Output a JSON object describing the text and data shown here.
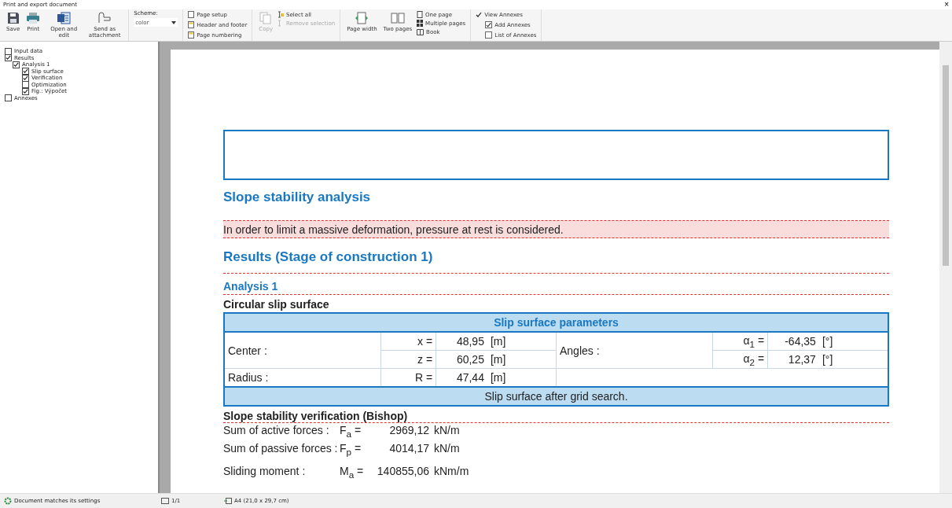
{
  "window": {
    "title": "Print and export document",
    "close": "×"
  },
  "toolbar": {
    "buttons": [
      {
        "label": "Save"
      },
      {
        "label": "Print"
      },
      {
        "label": "Open and edit"
      },
      {
        "label": "Send as attachment"
      }
    ],
    "scheme": {
      "label": "Scheme:",
      "value": "color"
    },
    "page_items": [
      {
        "label": "Page setup"
      },
      {
        "label": "Header and footer"
      },
      {
        "label": "Page numbering"
      }
    ],
    "copy": {
      "label": "Copy",
      "disabled": true
    },
    "selection_items": [
      {
        "label": "Select all",
        "disabled": false
      },
      {
        "label": "Remove selection",
        "disabled": true
      }
    ],
    "view_buttons": [
      {
        "label": "Page width"
      },
      {
        "label": "Two pages"
      }
    ],
    "page_modes": [
      {
        "label": "One page"
      },
      {
        "label": "Multiple pages"
      },
      {
        "label": "Book"
      }
    ],
    "annexes": [
      {
        "label": "View Annexes",
        "checked": true
      },
      {
        "label": "Add Annexes",
        "checked": true
      },
      {
        "label": "List of Annexes",
        "checked": false
      }
    ]
  },
  "tree": [
    {
      "label": "Input data",
      "checked": false
    },
    {
      "label": "Results",
      "checked": true,
      "children": [
        {
          "label": "Analysis 1",
          "checked": true,
          "children": [
            {
              "label": "Slip surface",
              "checked": true
            },
            {
              "label": "Verification",
              "checked": true
            },
            {
              "label": "Optimization",
              "checked": false
            },
            {
              "label": "Fig.: Výpočet",
              "checked": true
            }
          ]
        }
      ]
    },
    {
      "label": "Annexes",
      "checked": false
    }
  ],
  "document": {
    "title": "Slope stability analysis",
    "note": "In order to limit a massive deformation, pressure at rest is considered.",
    "results_heading": "Results (Stage of construction 1)",
    "analysis_heading": "Analysis 1",
    "section_heading": "Circular slip surface",
    "table": {
      "title": "Slip surface parameters",
      "center_label": "Center :",
      "angles_label": "Angles :",
      "radius_label": "Radius :",
      "rows": [
        [
          "x =",
          "48,95",
          "[m]",
          "α$_{1}$ =",
          "-64,35",
          "[°]"
        ],
        [
          "z =",
          "60,25",
          "[m]",
          "α$_{2}$ =",
          "12,37",
          "[°]"
        ]
      ],
      "radius": [
        "R =",
        "47,44",
        "[m]"
      ],
      "footer": "Slip surface after grid search."
    },
    "verification_heading": "Slope stability verification (Bishop)",
    "results": [
      {
        "label": "Sum of active forces :",
        "symbol": "F$_{a}$ =",
        "value": "2969,12",
        "unit": "kN/m"
      },
      {
        "label": "Sum of passive forces :",
        "symbol": "F$_{p}$ =",
        "value": "4014,17",
        "unit": "kN/m"
      },
      {
        "label": "Sliding moment :",
        "symbol": "M$_{a}$ =",
        "value": "140855,06",
        "unit": "kNm/m"
      }
    ]
  },
  "status_bar": {
    "message": "Document matches its settings",
    "pages": "1/1",
    "paper": "A4 (21,0 x 29,7 cm)"
  }
}
